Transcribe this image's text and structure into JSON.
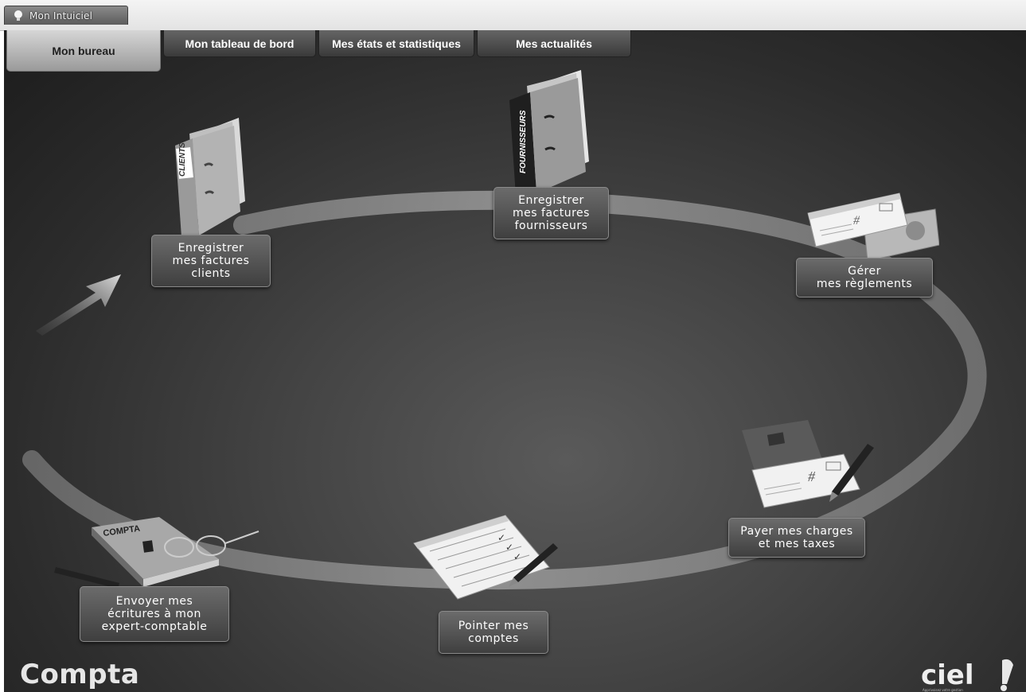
{
  "app_tab": {
    "label": "Mon Intuiciel"
  },
  "nav": [
    {
      "label": "Mon bureau",
      "active": true
    },
    {
      "label": "Mon tableau de bord",
      "active": false
    },
    {
      "label": "Mes états et statistiques",
      "active": false
    },
    {
      "label": "Mes actualités",
      "active": false
    }
  ],
  "steps": {
    "clients": {
      "label": "Enregistrer\nmes factures\nclients",
      "binder_text": "CLIENTS"
    },
    "fournisseurs": {
      "label": "Enregistrer\nmes factures\nfournisseurs",
      "binder_text": "FOURNISSEURS"
    },
    "reglements": {
      "label": "Gérer\nmes règlements"
    },
    "charges": {
      "label": "Payer mes charges\net mes taxes"
    },
    "pointer": {
      "label": "Pointer mes\ncomptes"
    },
    "envoyer": {
      "label": "Envoyer mes\nécritures à mon\nexpert-comptable",
      "book_text": "COMPTA"
    }
  },
  "module_title": "Compta",
  "brand": {
    "name": "ciel",
    "tagline": "Apprivoisez votre gestion"
  },
  "colors": {
    "ring": "#8c8c8c",
    "stage_dark": "#1c1c1c",
    "label_bg": "#4f4f4f"
  },
  "icons": [
    "lightbulb-icon",
    "arrow-icon",
    "binder-icon",
    "cheque-icon",
    "checkbook-icon",
    "checklist-icon",
    "accounting-book-icon",
    "pen-icon",
    "glasses-icon"
  ]
}
